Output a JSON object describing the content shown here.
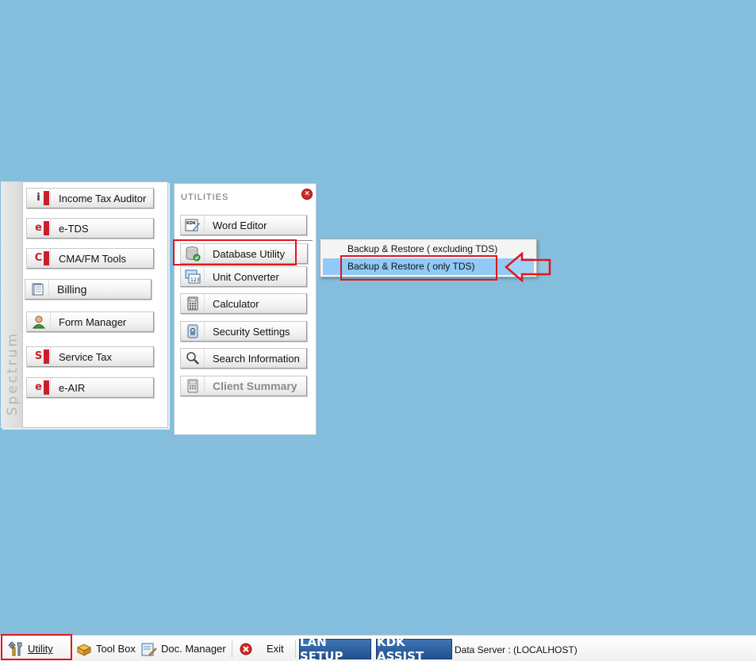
{
  "spectrum": {
    "label": "Spectrum",
    "buttons": [
      {
        "label": "Income Tax Auditor",
        "icon": "income-tax-icon"
      },
      {
        "label": "e-TDS",
        "icon": "etds-icon"
      },
      {
        "label": "CMA/FM Tools",
        "icon": "cma-icon"
      },
      {
        "label": "Billing",
        "icon": "billing-icon"
      },
      {
        "label": "Form Manager",
        "icon": "form-manager-icon"
      },
      {
        "label": "Service Tax",
        "icon": "service-tax-icon"
      },
      {
        "label": "e-AIR",
        "icon": "eair-icon"
      }
    ]
  },
  "utilities": {
    "title": "UTILITIES",
    "close_glyph": "×",
    "buttons": [
      {
        "label": "Word Editor",
        "icon": "word-editor-icon"
      },
      {
        "label": "Database Utility",
        "icon": "database-icon"
      },
      {
        "label": "Unit Converter",
        "icon": "unit-converter-icon"
      },
      {
        "label": "Calculator",
        "icon": "calculator-icon"
      },
      {
        "label": "Security Settings",
        "icon": "security-icon"
      },
      {
        "label": "Search Information",
        "icon": "search-icon"
      },
      {
        "label": "Client Summary",
        "icon": "client-summary-icon"
      }
    ]
  },
  "submenu": {
    "items": [
      {
        "label": "Backup & Restore ( excluding TDS)",
        "selected": false
      },
      {
        "label": "Backup & Restore ( only TDS)",
        "selected": true
      }
    ]
  },
  "taskbar": {
    "utility": "Utility",
    "toolbox": "Tool Box",
    "doc_manager": "Doc. Manager",
    "exit": "Exit",
    "lan_setup": "LAN SETUP",
    "kdk_assist": "KDK ASSIST",
    "server": "Data Server : (LOCALHOST)"
  },
  "colors": {
    "desktop": "#85bedd",
    "highlight": "#e0151c",
    "selection": "#91c9f7"
  }
}
